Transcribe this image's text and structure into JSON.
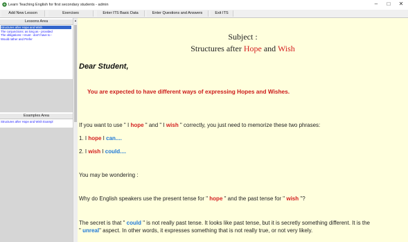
{
  "window": {
    "title": "Learn Teaching English for first secondary students - admin",
    "minimize": "–",
    "maximize": "□",
    "close": "✕"
  },
  "menu": {
    "items": [
      "Add New Lesson",
      "Exercises",
      "Enter ITS Basic Data",
      "Enter Questions and Answers",
      "Exit ITS"
    ]
  },
  "lessons_area": {
    "header": "Lessons Area",
    "items": [
      "Structures after Hope and Wish",
      "The conjunctions: as long as - provided",
      "The obligations: I must - don't have to -",
      "Would rather and Prefer"
    ]
  },
  "examples_area": {
    "header": "Examples Area",
    "items": [
      "Structures after Hope and Wish Exampl"
    ]
  },
  "content": {
    "subject_label": "Subject :",
    "subject_pre": "Structures after ",
    "subject_hope": "Hope",
    "subject_and": " and ",
    "subject_wish": "Wish",
    "greeting": "Dear Student,",
    "expected": "You are expected to have different ways of expressing Hopes and Wishes.",
    "line1": {
      "a": "If you want to use \" I ",
      "b": "hope",
      "c": " \" and \" I ",
      "d": "wish",
      "e": " \" correctly, you just need to memorize these two phrases:"
    },
    "phrase1": {
      "num": "1. I ",
      "a": "hope",
      "b": " I ",
      "c": "can...."
    },
    "phrase2": {
      "num": "2. I ",
      "a": "wish",
      "b": " I ",
      "c": "could...."
    },
    "wondering": "You may be wondering :",
    "question": {
      "a": "Why do English speakers use the present tense for \" ",
      "b": "hope",
      "c": " \" and the past tense for \" ",
      "d": "wish",
      "e": " \"?"
    },
    "secret": {
      "a": "The secret is that \" ",
      "b": "could",
      "c": " \" is not really past tense. It looks like past tense, but it is secretly something different. It is the",
      "d": "\" ",
      "e": "unreal",
      "f": "\" aspect. In other words, it expresses something that is not really true, or not very likely."
    }
  },
  "colors": {
    "content_bg": "#ffffdd",
    "accent_red": "#d42020",
    "accent_blue": "#1e78d8",
    "selection": "#3366cc"
  }
}
